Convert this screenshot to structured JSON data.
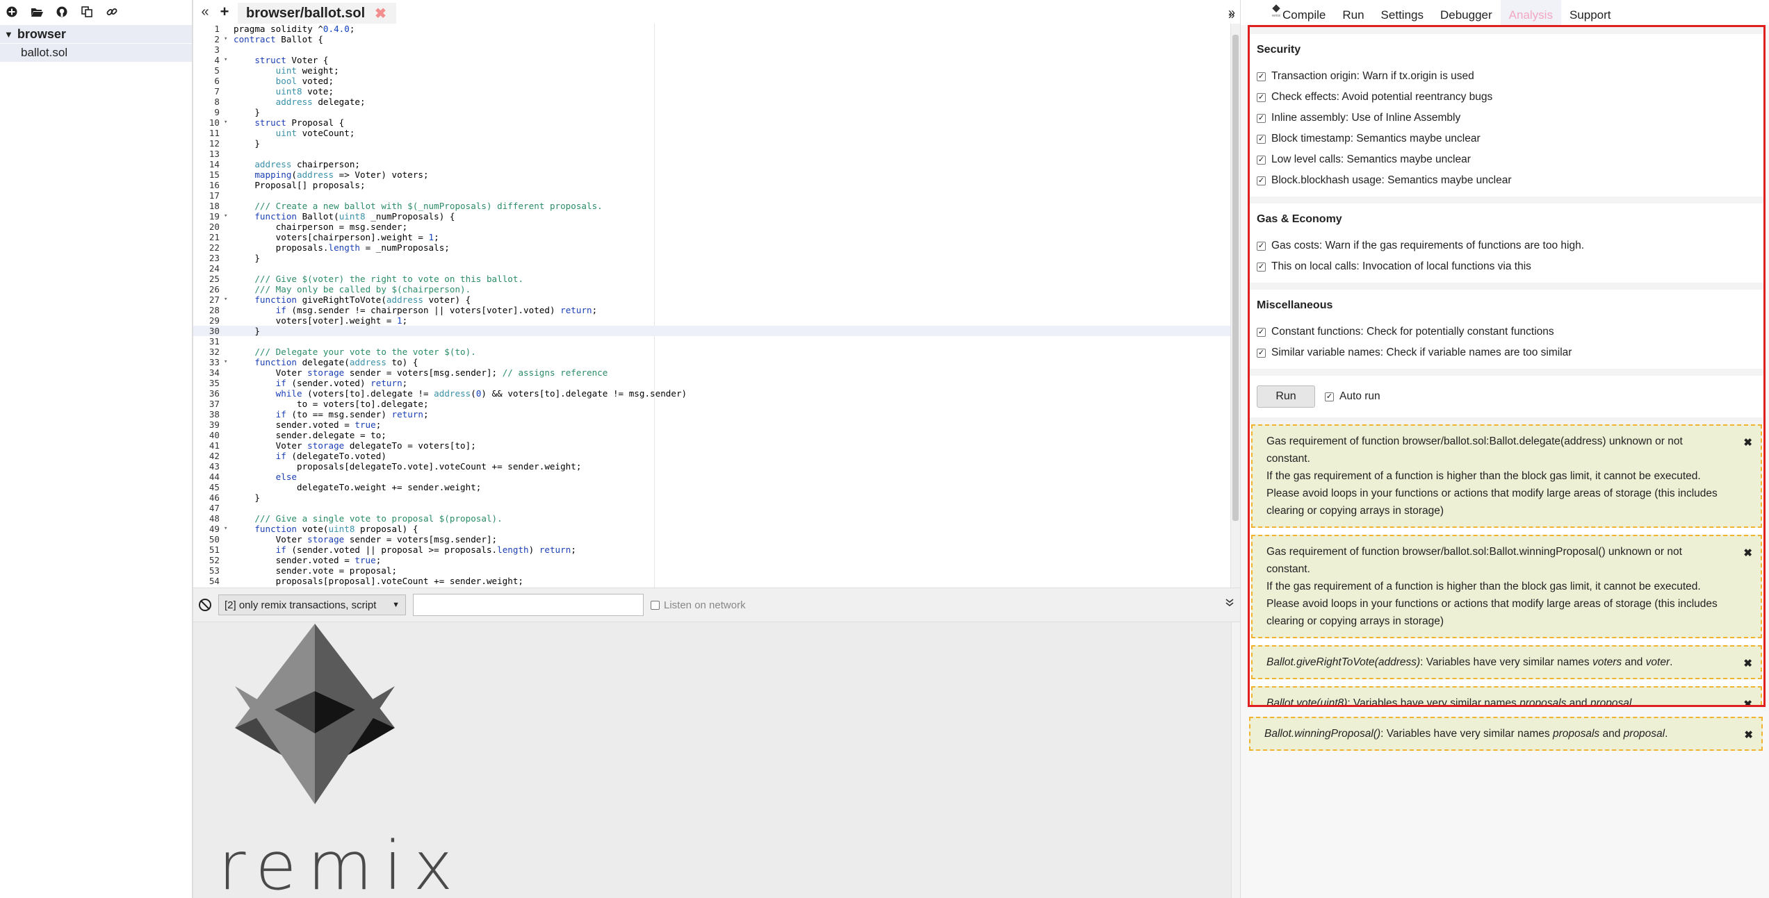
{
  "explorer": {
    "toolbar_icons": [
      "plus-circle-icon",
      "folder-open-icon",
      "github-icon",
      "copy-icon",
      "link-icon"
    ],
    "folder": "browser",
    "files": [
      "ballot.sol"
    ]
  },
  "editor": {
    "tab_title": "browser/ballot.sol",
    "tab_close": "✖",
    "collapse_left": "«",
    "new_tab": "+",
    "expand_right": "»",
    "active_line": 30,
    "lines": [
      {
        "n": "1",
        "fold": "",
        "html": "pragma solidity ^<span class='nu'>0.4.0</span>;"
      },
      {
        "n": "2",
        "fold": "▾",
        "html": "<span class='kw'>contract</span> Ballot {"
      },
      {
        "n": "3",
        "fold": "",
        "html": ""
      },
      {
        "n": "4",
        "fold": "▾",
        "html": "    <span class='kw'>struct</span> Voter {"
      },
      {
        "n": "5",
        "fold": "",
        "html": "        <span class='ty'>uint</span> weight;"
      },
      {
        "n": "6",
        "fold": "",
        "html": "        <span class='ty'>bool</span> voted;"
      },
      {
        "n": "7",
        "fold": "",
        "html": "        <span class='ty'>uint8</span> vote;"
      },
      {
        "n": "8",
        "fold": "",
        "html": "        <span class='ty'>address</span> delegate;"
      },
      {
        "n": "9",
        "fold": "",
        "html": "    }"
      },
      {
        "n": "10",
        "fold": "▾",
        "html": "    <span class='kw'>struct</span> Proposal {"
      },
      {
        "n": "11",
        "fold": "",
        "html": "        <span class='ty'>uint</span> voteCount;"
      },
      {
        "n": "12",
        "fold": "",
        "html": "    }"
      },
      {
        "n": "13",
        "fold": "",
        "html": ""
      },
      {
        "n": "14",
        "fold": "",
        "html": "    <span class='ty'>address</span> chairperson;"
      },
      {
        "n": "15",
        "fold": "",
        "html": "    <span class='kw'>mapping</span>(<span class='ty'>address</span> => Voter) voters;"
      },
      {
        "n": "16",
        "fold": "",
        "html": "    Proposal[] proposals;"
      },
      {
        "n": "17",
        "fold": "",
        "html": ""
      },
      {
        "n": "18",
        "fold": "",
        "html": "    <span class='cm'>/// Create a new ballot with $(_numProposals) different proposals.</span>"
      },
      {
        "n": "19",
        "fold": "▾",
        "html": "    <span class='kw'>function</span> Ballot(<span class='ty'>uint8</span> _numProposals) {"
      },
      {
        "n": "20",
        "fold": "",
        "html": "        chairperson = msg.sender;"
      },
      {
        "n": "21",
        "fold": "",
        "html": "        voters[chairperson].weight = <span class='nu'>1</span>;"
      },
      {
        "n": "22",
        "fold": "",
        "html": "        proposals.<span class='kw'>length</span> = _numProposals;"
      },
      {
        "n": "23",
        "fold": "",
        "html": "    }"
      },
      {
        "n": "24",
        "fold": "",
        "html": ""
      },
      {
        "n": "25",
        "fold": "",
        "html": "    <span class='cm'>/// Give $(voter) the right to vote on this ballot.</span>"
      },
      {
        "n": "26",
        "fold": "",
        "html": "    <span class='cm'>/// May only be called by $(chairperson).</span>"
      },
      {
        "n": "27",
        "fold": "▾",
        "html": "    <span class='kw'>function</span> giveRightToVote(<span class='ty'>address</span> voter) {"
      },
      {
        "n": "28",
        "fold": "",
        "html": "        <span class='kw'>if</span> (msg.sender != chairperson || voters[voter].voted) <span class='kw'>return</span>;"
      },
      {
        "n": "29",
        "fold": "",
        "html": "        voters[voter].weight = <span class='nu'>1</span>;"
      },
      {
        "n": "30",
        "fold": "",
        "html": "    }"
      },
      {
        "n": "31",
        "fold": "",
        "html": ""
      },
      {
        "n": "32",
        "fold": "",
        "html": "    <span class='cm'>/// Delegate your vote to the voter $(to).</span>"
      },
      {
        "n": "33",
        "fold": "▾",
        "html": "    <span class='kw'>function</span> delegate(<span class='ty'>address</span> to) {"
      },
      {
        "n": "34",
        "fold": "",
        "html": "        Voter <span class='kw'>storage</span> sender = voters[msg.sender]; <span class='cm'>// assigns reference</span>"
      },
      {
        "n": "35",
        "fold": "",
        "html": "        <span class='kw'>if</span> (sender.voted) <span class='kw'>return</span>;"
      },
      {
        "n": "36",
        "fold": "",
        "html": "        <span class='kw'>while</span> (voters[to].delegate != <span class='ty'>address</span>(<span class='nu'>0</span>) && voters[to].delegate != msg.sender)"
      },
      {
        "n": "37",
        "fold": "",
        "html": "            to = voters[to].delegate;"
      },
      {
        "n": "38",
        "fold": "",
        "html": "        <span class='kw'>if</span> (to == msg.sender) <span class='kw'>return</span>;"
      },
      {
        "n": "39",
        "fold": "",
        "html": "        sender.voted = <span class='kw'>true</span>;"
      },
      {
        "n": "40",
        "fold": "",
        "html": "        sender.delegate = to;"
      },
      {
        "n": "41",
        "fold": "",
        "html": "        Voter <span class='kw'>storage</span> delegateTo = voters[to];"
      },
      {
        "n": "42",
        "fold": "",
        "html": "        <span class='kw'>if</span> (delegateTo.voted)"
      },
      {
        "n": "43",
        "fold": "",
        "html": "            proposals[delegateTo.vote].voteCount += sender.weight;"
      },
      {
        "n": "44",
        "fold": "",
        "html": "        <span class='kw'>else</span>"
      },
      {
        "n": "45",
        "fold": "",
        "html": "            delegateTo.weight += sender.weight;"
      },
      {
        "n": "46",
        "fold": "",
        "html": "    }"
      },
      {
        "n": "47",
        "fold": "",
        "html": ""
      },
      {
        "n": "48",
        "fold": "",
        "html": "    <span class='cm'>/// Give a single vote to proposal $(proposal).</span>"
      },
      {
        "n": "49",
        "fold": "▾",
        "html": "    <span class='kw'>function</span> vote(<span class='ty'>uint8</span> proposal) {"
      },
      {
        "n": "50",
        "fold": "",
        "html": "        Voter <span class='kw'>storage</span> sender = voters[msg.sender];"
      },
      {
        "n": "51",
        "fold": "",
        "html": "        <span class='kw'>if</span> (sender.voted || proposal >= proposals.<span class='kw'>length</span>) <span class='kw'>return</span>;"
      },
      {
        "n": "52",
        "fold": "",
        "html": "        sender.voted = <span class='kw'>true</span>;"
      },
      {
        "n": "53",
        "fold": "",
        "html": "        sender.vote = proposal;"
      },
      {
        "n": "54",
        "fold": "",
        "html": "        proposals[proposal].voteCount += sender.weight;"
      }
    ]
  },
  "terminal": {
    "filter_value": "[2] only remix transactions, script",
    "search_value": "",
    "listen_label": "Listen on network",
    "toggle": "»",
    "logo_word": "remix"
  },
  "right_panel": {
    "tabs": [
      "Compile",
      "Run",
      "Settings",
      "Debugger",
      "Analysis",
      "Support"
    ],
    "active_tab": "Analysis",
    "logo_caption": "remix",
    "sections": [
      {
        "title": "Security",
        "items": [
          "Transaction origin: Warn if tx.origin is used",
          "Check effects: Avoid potential reentrancy bugs",
          "Inline assembly: Use of Inline Assembly",
          "Block timestamp: Semantics maybe unclear",
          "Low level calls: Semantics maybe unclear",
          "Block.blockhash usage: Semantics maybe unclear"
        ]
      },
      {
        "title": "Gas & Economy",
        "items": [
          "Gas costs: Warn if the gas requirements of functions are too high.",
          "This on local calls: Invocation of local functions via this"
        ]
      },
      {
        "title": "Miscellaneous",
        "items": [
          "Constant functions: Check for potentially constant functions",
          "Similar variable names: Check if variable names are too similar"
        ]
      }
    ],
    "run_label": "Run",
    "autorun_label": "Auto run",
    "close_glyph": "✖",
    "warnings": [
      {
        "kind": "gas",
        "p1": "Gas requirement of function browser/ballot.sol:Ballot.delegate(address) unknown or not constant.",
        "p2": "If the gas requirement of a function is higher than the block gas limit, it cannot be executed. Please avoid loops in your functions or actions that modify large areas of storage (this includes clearing or copying arrays in storage)"
      },
      {
        "kind": "gas",
        "p1": "Gas requirement of function browser/ballot.sol:Ballot.winningProposal() unknown or not constant.",
        "p2": "If the gas requirement of a function is higher than the block gas limit, it cannot be executed. Please avoid loops in your functions or actions that modify large areas of storage (this includes clearing or copying arrays in storage)"
      },
      {
        "kind": "name",
        "fn": "Ballot.giveRightToVote(address)",
        "pre": ": Variables have very similar names ",
        "a": "voters",
        "mid": " and ",
        "b": "voter",
        "post": "."
      },
      {
        "kind": "name",
        "fn": "Ballot.vote(uint8)",
        "pre": ": Variables have very similar names ",
        "a": "proposals",
        "mid": " and ",
        "b": "proposal",
        "post": "."
      },
      {
        "kind": "name",
        "fn": "Ballot.winningProposal()",
        "pre": ": Variables have very similar names ",
        "a": "proposals",
        "mid": " and ",
        "b": "proposal",
        "post": "."
      }
    ]
  },
  "colors": {
    "accent_red": "#e02020",
    "warning_bg": "#eef0d6",
    "warning_border": "#f1b32e",
    "active_tab": "#f3a7c0"
  }
}
